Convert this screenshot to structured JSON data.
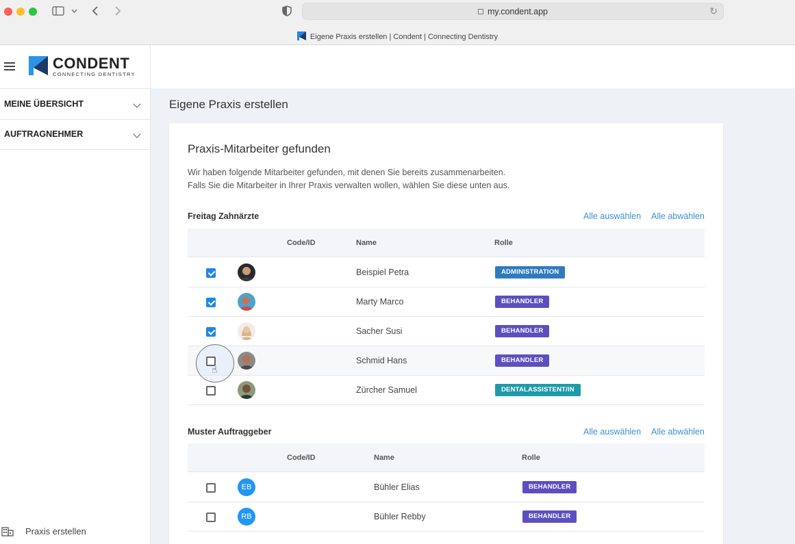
{
  "browser": {
    "url": "my.condent.app",
    "tab_title": "Eigene Praxis erstellen | Condent | Connecting Dentistry"
  },
  "brand": {
    "name": "CONDENT",
    "tagline": "CONNECTING DENTISTRY",
    "color_primary": "#1e88e5",
    "color_dark": "#1a3b66"
  },
  "sidebar": {
    "items": [
      {
        "label": "MEINE ÜBERSICHT"
      },
      {
        "label": "AUFTRAGNEHMER"
      }
    ],
    "footer_label": "Praxis erstellen"
  },
  "main": {
    "page_title": "Eigene Praxis erstellen",
    "card_title": "Praxis-Mitarbeiter gefunden",
    "desc_line1": "Wir haben folgende Mitarbeiter gefunden, mit denen Sie bereits zusammenarbeiten.",
    "desc_line2": "Falls Sie die Mitarbeiter in Ihrer Praxis verwalten wollen, wählen Sie diese unten aus.",
    "select_all": "Alle auswählen",
    "deselect_all": "Alle abwählen",
    "columns": {
      "code": "Code/ID",
      "name": "Name",
      "role": "Rolle"
    },
    "groups": [
      {
        "title": "Freitag Zahnärzte",
        "rows": [
          {
            "name": "Beispiel Petra",
            "role": "ADMINISTRATION",
            "role_color": "#2f7bbf",
            "checked": true,
            "avatar": "photo"
          },
          {
            "name": "Marty Marco",
            "role": "BEHANDLER",
            "role_color": "#5c4fc0",
            "checked": true,
            "avatar": "photo"
          },
          {
            "name": "Sacher Susi",
            "role": "BEHANDLER",
            "role_color": "#5c4fc0",
            "checked": true,
            "avatar": "photo"
          },
          {
            "name": "Schmid Hans",
            "role": "BEHANDLER",
            "role_color": "#5c4fc0",
            "checked": false,
            "avatar": "photo"
          },
          {
            "name": "Zürcher Samuel",
            "role": "DENTALASSISTENT/IN",
            "role_color": "#1f9aa8",
            "checked": false,
            "avatar": "photo"
          }
        ]
      },
      {
        "title": "Muster Auftraggeber",
        "rows": [
          {
            "name": "Bühler Elias",
            "role": "BEHANDLER",
            "role_color": "#5c4fc0",
            "checked": false,
            "initials": "EB"
          },
          {
            "name": "Bühler Rebby",
            "role": "BEHANDLER",
            "role_color": "#5c4fc0",
            "checked": false,
            "initials": "RB"
          }
        ]
      }
    ]
  }
}
